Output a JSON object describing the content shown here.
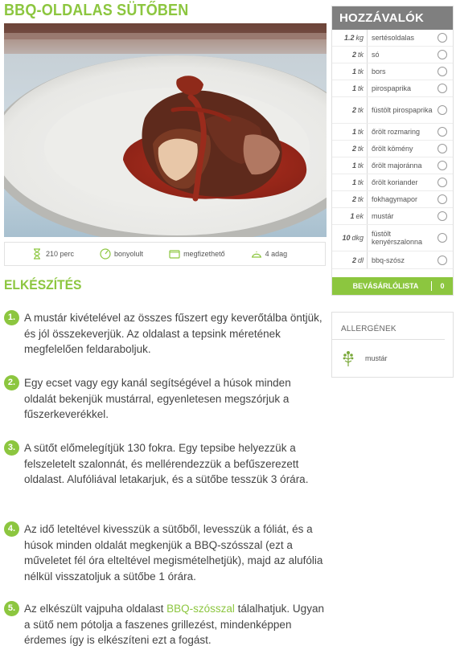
{
  "recipe": {
    "title": "BBQ-OLDALAS SÜTŐBEN"
  },
  "hero": {
    "icon": "plated-bbq-ribs-photo"
  },
  "meta": {
    "time": "210 perc",
    "difficulty": "bonyolult",
    "price": "megfizethető",
    "servings": "4 adag"
  },
  "preparation": {
    "title": "ELKÉSZÍTÉS",
    "steps": [
      {
        "num": "1.",
        "text": "A mustár kivételével az összes fűszert egy keverőtálba öntjük, és jól összekeverjük. Az oldalast a tepsink méretének megfelelően feldaraboljuk."
      },
      {
        "num": "2.",
        "text": "Egy ecset vagy egy kanál segítségével a húsok minden oldalát bekenjük mustárral, egyenletesen megszórjuk a fűszerkeverékkel."
      },
      {
        "num": "3.",
        "text": "A sütőt előmelegítjük 130 fokra. Egy tepsibe helyezzük a felszeletelt szalonnát, és mellérendezzük a befűszerezett oldalast. Alufóliával letakarjuk, és a sütőbe tesszük 3 órára."
      },
      {
        "num": "4.",
        "text": "Az idő leteltével kivesszük a sütőből, levesszük a fóliát, és a húsok minden oldalát megkenjük a BBQ-szósszal (ezt a műveletet fél óra elteltével megismételhetjük), majd az alufólia nélkül visszatoljuk a sütőbe 1 órára."
      },
      {
        "num": "5.",
        "text_before": "Az elkészült vajpuha oldalast ",
        "link": "BBQ-szósszal",
        "text_after": " tálalhatjuk. Ugyan a sütő nem pótolja a faszenes grillezést, mindenképpen érdemes így is elkészíteni ezt a fogást."
      }
    ]
  },
  "ingredients": {
    "title": "HOZZÁVALÓK",
    "items": [
      {
        "amount": "1.2",
        "unit": "kg",
        "name": "sertésoldalas"
      },
      {
        "amount": "2",
        "unit": "tk",
        "name": "só"
      },
      {
        "amount": "1",
        "unit": "tk",
        "name": "bors"
      },
      {
        "amount": "1",
        "unit": "tk",
        "name": "pirospaprika"
      },
      {
        "amount": "2",
        "unit": "tk",
        "name": "füstölt pirospaprika"
      },
      {
        "amount": "1",
        "unit": "tk",
        "name": "őrölt rozmaring"
      },
      {
        "amount": "2",
        "unit": "tk",
        "name": "őrölt kömény"
      },
      {
        "amount": "1",
        "unit": "tk",
        "name": "őrölt majoránna"
      },
      {
        "amount": "1",
        "unit": "tk",
        "name": "őrölt koriander"
      },
      {
        "amount": "2",
        "unit": "tk",
        "name": "fokhagymapor"
      },
      {
        "amount": "1",
        "unit": "ek",
        "name": "mustár"
      },
      {
        "amount": "10",
        "unit": "dkg",
        "name": "füstölt kenyérszalonna"
      },
      {
        "amount": "2",
        "unit": "dl",
        "name": "bbq-szósz"
      }
    ],
    "shopping_label": "BEVÁSÁRLÓLISTA",
    "shopping_count": "0"
  },
  "allergens": {
    "title": "ALLERGÉNEK",
    "items": [
      {
        "name": "mustár",
        "icon": "mustard-plant-icon"
      }
    ]
  },
  "colors": {
    "accent": "#8cc63f",
    "header_gray": "#7f7f7f",
    "sauce": "#a3291f"
  }
}
